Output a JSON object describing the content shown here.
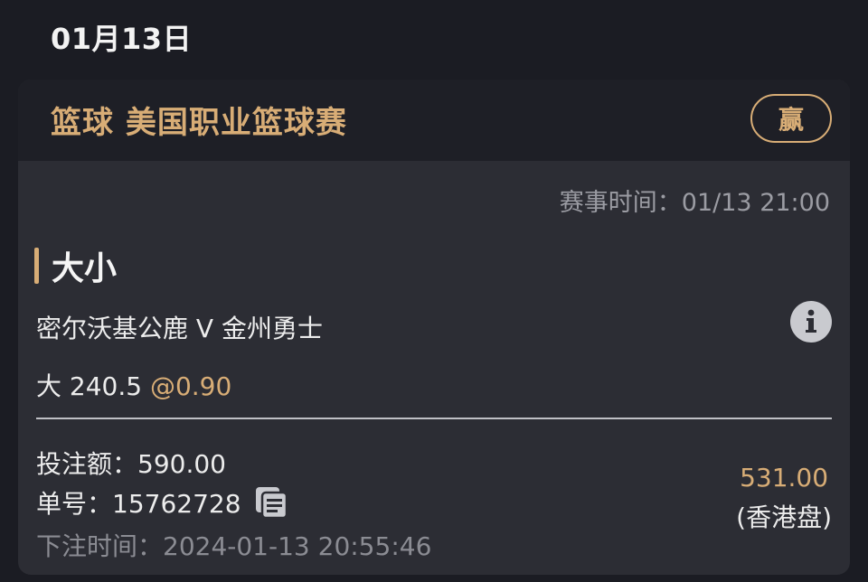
{
  "date": "01月13日",
  "card": {
    "league": "篮球 美国职业篮球赛",
    "result": "赢",
    "event_time": "赛事时间：01/13 21:00",
    "market": "大小",
    "match": "密尔沃基公鹿 V 金州勇士",
    "selection": "大 240.5",
    "odds": "@0.90",
    "stake": "投注额：590.00",
    "ticket": "单号：15762728",
    "bet_time": "下注时间：2024-01-13 20:55:46",
    "payout": "531.00",
    "odds_type": "(香港盘)"
  },
  "colors": {
    "accent": "#d8ad76",
    "background": "#1b1c23",
    "card": "#2c2d34",
    "card_header": "#1e1f26"
  },
  "icons": {
    "info": "info-icon",
    "copy": "copy-icon"
  }
}
